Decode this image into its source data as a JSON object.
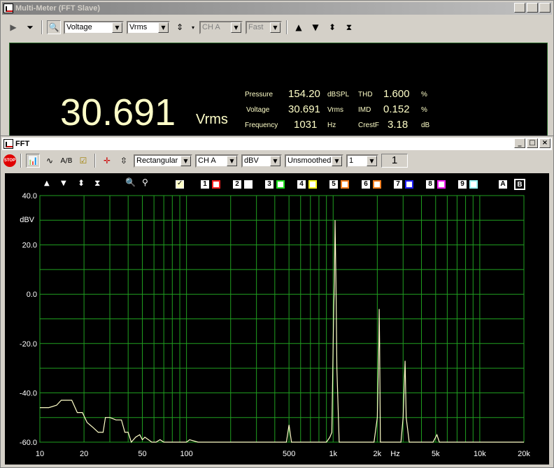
{
  "meter_window": {
    "title": "Multi-Meter (FFT Slave)",
    "selects": {
      "measure": "Voltage",
      "unit": "Vrms",
      "channel": "CH A",
      "speed": "Fast"
    },
    "display": {
      "main_value": "30.691",
      "main_unit": "Vrms",
      "rows": [
        {
          "label": "Pressure",
          "value": "154.20",
          "unit": "dBSPL",
          "label2": "THD",
          "value2": "1.600",
          "unit2": "%"
        },
        {
          "label": "Voltage",
          "value": "30.691",
          "unit": "Vrms",
          "label2": "IMD",
          "value2": "0.152",
          "unit2": "%"
        },
        {
          "label": "Frequency",
          "value": "1031",
          "unit": "Hz",
          "label2": "CrestF",
          "value2": "3.18",
          "unit2": "dB"
        }
      ]
    }
  },
  "fft_window": {
    "title": "FFT",
    "stop_label": "STOP",
    "toolbar": {
      "ab_label": "A/B",
      "window": "Rectangular",
      "channel": "CH A",
      "scale": "dBV",
      "smoothing": "Unsmoothed",
      "avg_select": "1",
      "avg_display": "1"
    },
    "channels": [
      "1",
      "2",
      "3",
      "4",
      "5",
      "6",
      "7",
      "8",
      "9"
    ],
    "channel_colors": [
      "#ff2020",
      "#ffffff",
      "#20e020",
      "#ffff20",
      "#ff8020",
      "#ff8020",
      "#2020ff",
      "#ff20ff",
      "#a0ffff",
      "#ffffff"
    ],
    "ab": [
      "A",
      "B"
    ]
  },
  "chart_data": {
    "type": "line",
    "ylabel": "dBV",
    "xlabel": "Hz",
    "x_scale": "log",
    "xlim": [
      10,
      20000
    ],
    "ylim": [
      -60,
      40
    ],
    "y_ticks": [
      "40.0",
      "20.0",
      "0.0",
      "-20.0",
      "-40.0",
      "-60.0"
    ],
    "y_tick_values": [
      40,
      20,
      0,
      -20,
      -40,
      -60
    ],
    "x_ticks": [
      "10",
      "20",
      "50",
      "100",
      "500",
      "1k",
      "2k",
      "5k",
      "10k",
      "20k"
    ],
    "x_tick_values": [
      10,
      20,
      50,
      100,
      500,
      1000,
      2000,
      5000,
      10000,
      20000
    ],
    "grid": true,
    "series": [
      {
        "color": "#ffffc8",
        "x": [
          10,
          11.5,
          13,
          14,
          15,
          16.5,
          18,
          19.5,
          21,
          23,
          25,
          27,
          28,
          30,
          33,
          36,
          38,
          40,
          42,
          45,
          48,
          50,
          52,
          55,
          58,
          62,
          66,
          70,
          80,
          95,
          100,
          105,
          120,
          150,
          200,
          300,
          480,
          500,
          520,
          900,
          950,
          980,
          1000,
          1010,
          1020,
          1031,
          1045,
          1060,
          1100,
          1900,
          2000,
          2050,
          2062,
          2075,
          2100,
          2400,
          2900,
          3000,
          3093,
          3150,
          3300,
          4800,
          5000,
          5100,
          5300,
          8000,
          12000,
          20000
        ],
        "y": [
          -46,
          -46,
          -45,
          -43,
          -43,
          -43,
          -48,
          -48,
          -52,
          -54,
          -56,
          -56,
          -50,
          -50,
          -51,
          -51,
          -56,
          -56,
          -61,
          -58,
          -57,
          -59,
          -58,
          -59,
          -60,
          -60,
          -59,
          -60,
          -60,
          -60,
          -60,
          -59,
          -60,
          -60,
          -60,
          -60,
          -60,
          -53,
          -60,
          -60,
          -58,
          -56,
          -20,
          -5,
          5,
          30,
          5,
          -30,
          -60,
          -60,
          -50,
          -20,
          -6,
          -20,
          -60,
          -60,
          -60,
          -50,
          -27,
          -50,
          -60,
          -60,
          -58,
          -57,
          -60,
          -60,
          -60,
          -60
        ]
      }
    ]
  }
}
